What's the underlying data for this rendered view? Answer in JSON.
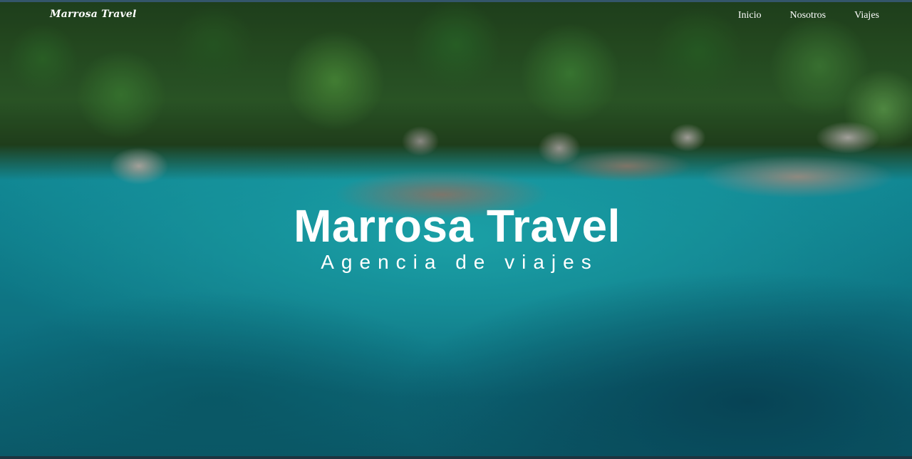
{
  "navbar": {
    "brand": "Marrosa Travel",
    "links": [
      {
        "label": "Inicio"
      },
      {
        "label": "Nosotros"
      },
      {
        "label": "Viajes"
      }
    ]
  },
  "hero": {
    "title": "Marrosa Travel",
    "subtitle": "Agencia de viajes",
    "background": "tropical-coast-photo"
  },
  "colors": {
    "text": "#ffffff",
    "water": "#1aaab6",
    "foliage": "#2f5f2a"
  }
}
